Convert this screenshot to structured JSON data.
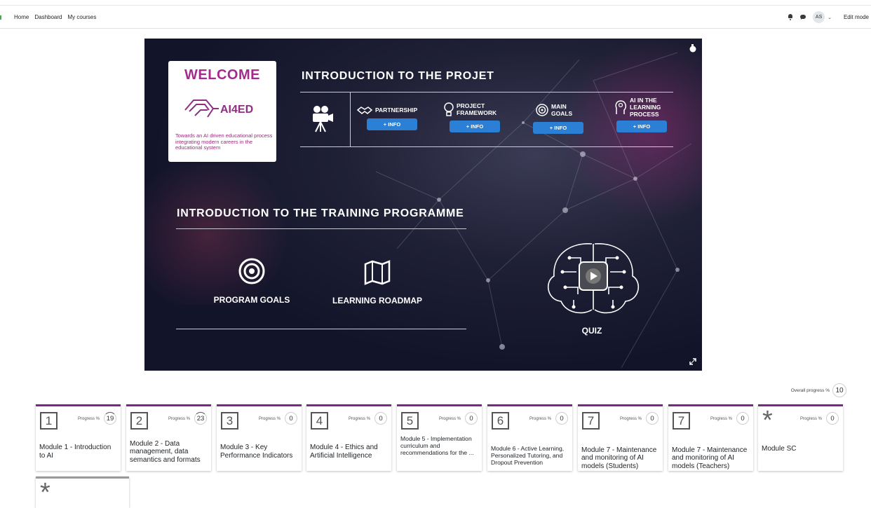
{
  "nav": {
    "home": "Home",
    "dashboard": "Dashboard",
    "courses": "My courses"
  },
  "user": {
    "initials": "AS",
    "edit_mode": "Edit mode"
  },
  "banner": {
    "welcome": "WELCOME",
    "logo_text": "AI4ED",
    "tagline": "Towards an AI driven educational process integrating modern careers in the educational system",
    "project_title": "INTRODUCTION TO THE PROJET",
    "project_items": [
      {
        "label": "PARTNERSHIP",
        "button": "+ INFO"
      },
      {
        "label": "PROJECT FRAMEWORK",
        "button": "+ INFO"
      },
      {
        "label": "MAIN GOALS",
        "button": "+ INFO"
      },
      {
        "label": "AI IN THE LEARNING PROCESS",
        "button": "+ INFO"
      }
    ],
    "training_title": "INTRODUCTION TO THE TRAINING PROGRAMME",
    "program_goals": "PROGRAM GOALS",
    "learning_roadmap": "LEARNING ROADMAP",
    "quiz": "QUIZ"
  },
  "overall": {
    "label": "Overall progress %",
    "value": "10"
  },
  "modules": [
    {
      "icon": "1",
      "progress_label": "Progress %",
      "progress": "19",
      "title": "Module 1 - Introduction to AI"
    },
    {
      "icon": "2",
      "progress_label": "Progress %",
      "progress": "23",
      "title": "Module 2 - Data management, data semantics and formats"
    },
    {
      "icon": "3",
      "progress_label": "Progress %",
      "progress": "0",
      "title": "Module 3 - Key Performance Indicators"
    },
    {
      "icon": "4",
      "progress_label": "Progress %",
      "progress": "0",
      "title": "Module 4 - Ethics and Artificial Intelligence"
    },
    {
      "icon": "5",
      "progress_label": "Progress %",
      "progress": "0",
      "title": "Module 5 - Implementation curriculum and recommendations for the ..."
    },
    {
      "icon": "6",
      "progress_label": "Progress %",
      "progress": "0",
      "title": "Module 6 - Active Learning, Personalized Tutoring, and Dropout Prevention"
    },
    {
      "icon": "7",
      "progress_label": "Progress %",
      "progress": "0",
      "title": "Module 7 - Maintenance and monitoring of AI models (Students)"
    },
    {
      "icon": "7",
      "progress_label": "Progress %",
      "progress": "0",
      "title": "Module 7 - Maintenance and monitoring of AI models (Teachers)"
    },
    {
      "icon": "*",
      "progress_label": "Progress %",
      "progress": "0",
      "title": "Module SC"
    }
  ],
  "extra_card_icon": "*",
  "colors": {
    "accent": "#7a2a86",
    "brand": "#a42a8e",
    "button": "#2b7fd4"
  }
}
